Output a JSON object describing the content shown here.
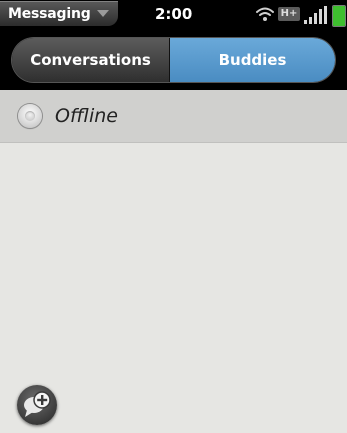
{
  "status_bar": {
    "app_menu_label": "Messaging",
    "time": "2:00",
    "network_type": "H+",
    "battery_level": 1.0,
    "icons": [
      "chevron-down-icon",
      "wifi-icon",
      "signal-icon",
      "battery-icon"
    ]
  },
  "tabs": [
    {
      "label": "Conversations",
      "selected": false
    },
    {
      "label": "Buddies",
      "selected": true
    }
  ],
  "presence": {
    "label": "Offline",
    "icon": "presence-radio-icon"
  },
  "actions": {
    "add_icon": "add-chat-icon"
  },
  "colors": {
    "selected_tab": "#5b9bd0",
    "content_background": "#e6e6e3",
    "status_row_background": "#d0d0ce",
    "battery": "#3fbf2f"
  }
}
